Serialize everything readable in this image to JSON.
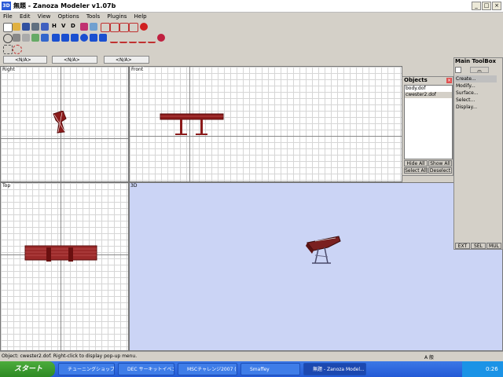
{
  "window": {
    "icon_text": "3D",
    "title": "無題 - Zanoza Modeler v1.07b",
    "controls": [
      "_",
      "□",
      "×"
    ]
  },
  "menu": [
    "File",
    "Edit",
    "View",
    "Options",
    "Tools",
    "Plugins",
    "Help"
  ],
  "toolbar1": {
    "letters": [
      "H",
      "V",
      "D"
    ]
  },
  "combos": [
    "<N/A>",
    "<N/A>",
    "<N/A>"
  ],
  "viewports": {
    "right": "Right",
    "front": "Front",
    "top": "Top",
    "perspective": "3D"
  },
  "objects_panel": {
    "title": "Objects",
    "items": [
      "body.dof",
      "cwester2.dof"
    ],
    "selected_index": 1,
    "buttons": [
      "Hide All",
      "Show All",
      "Select All",
      "Deselect"
    ]
  },
  "toolbox": {
    "title": "Main ToolBox",
    "items": [
      "Create...",
      "Modify...",
      "Surface...",
      "Select...",
      "Display..."
    ],
    "selected_index": 0,
    "buttons": [
      "EXT",
      "SEL",
      "MUL"
    ]
  },
  "status": {
    "message": "Object: cwester2.dof. Right-click to display pop-up menu.",
    "ime": "A 般"
  },
  "taskbar": {
    "start": "スタート",
    "tasks": [
      "チューニングショップ（カ...",
      "DEC サーキットイベント...",
      "MSCチャレンジ2007 (第...",
      "Smaffey",
      "無題 - Zanoza Model..."
    ],
    "active_index": 4,
    "clock": "0:26"
  },
  "colors": {
    "model": "#8b1a1a",
    "perspective_bg": "#cbd4f5",
    "taskbar": "#235ad6",
    "start": "#3a9a2e"
  }
}
